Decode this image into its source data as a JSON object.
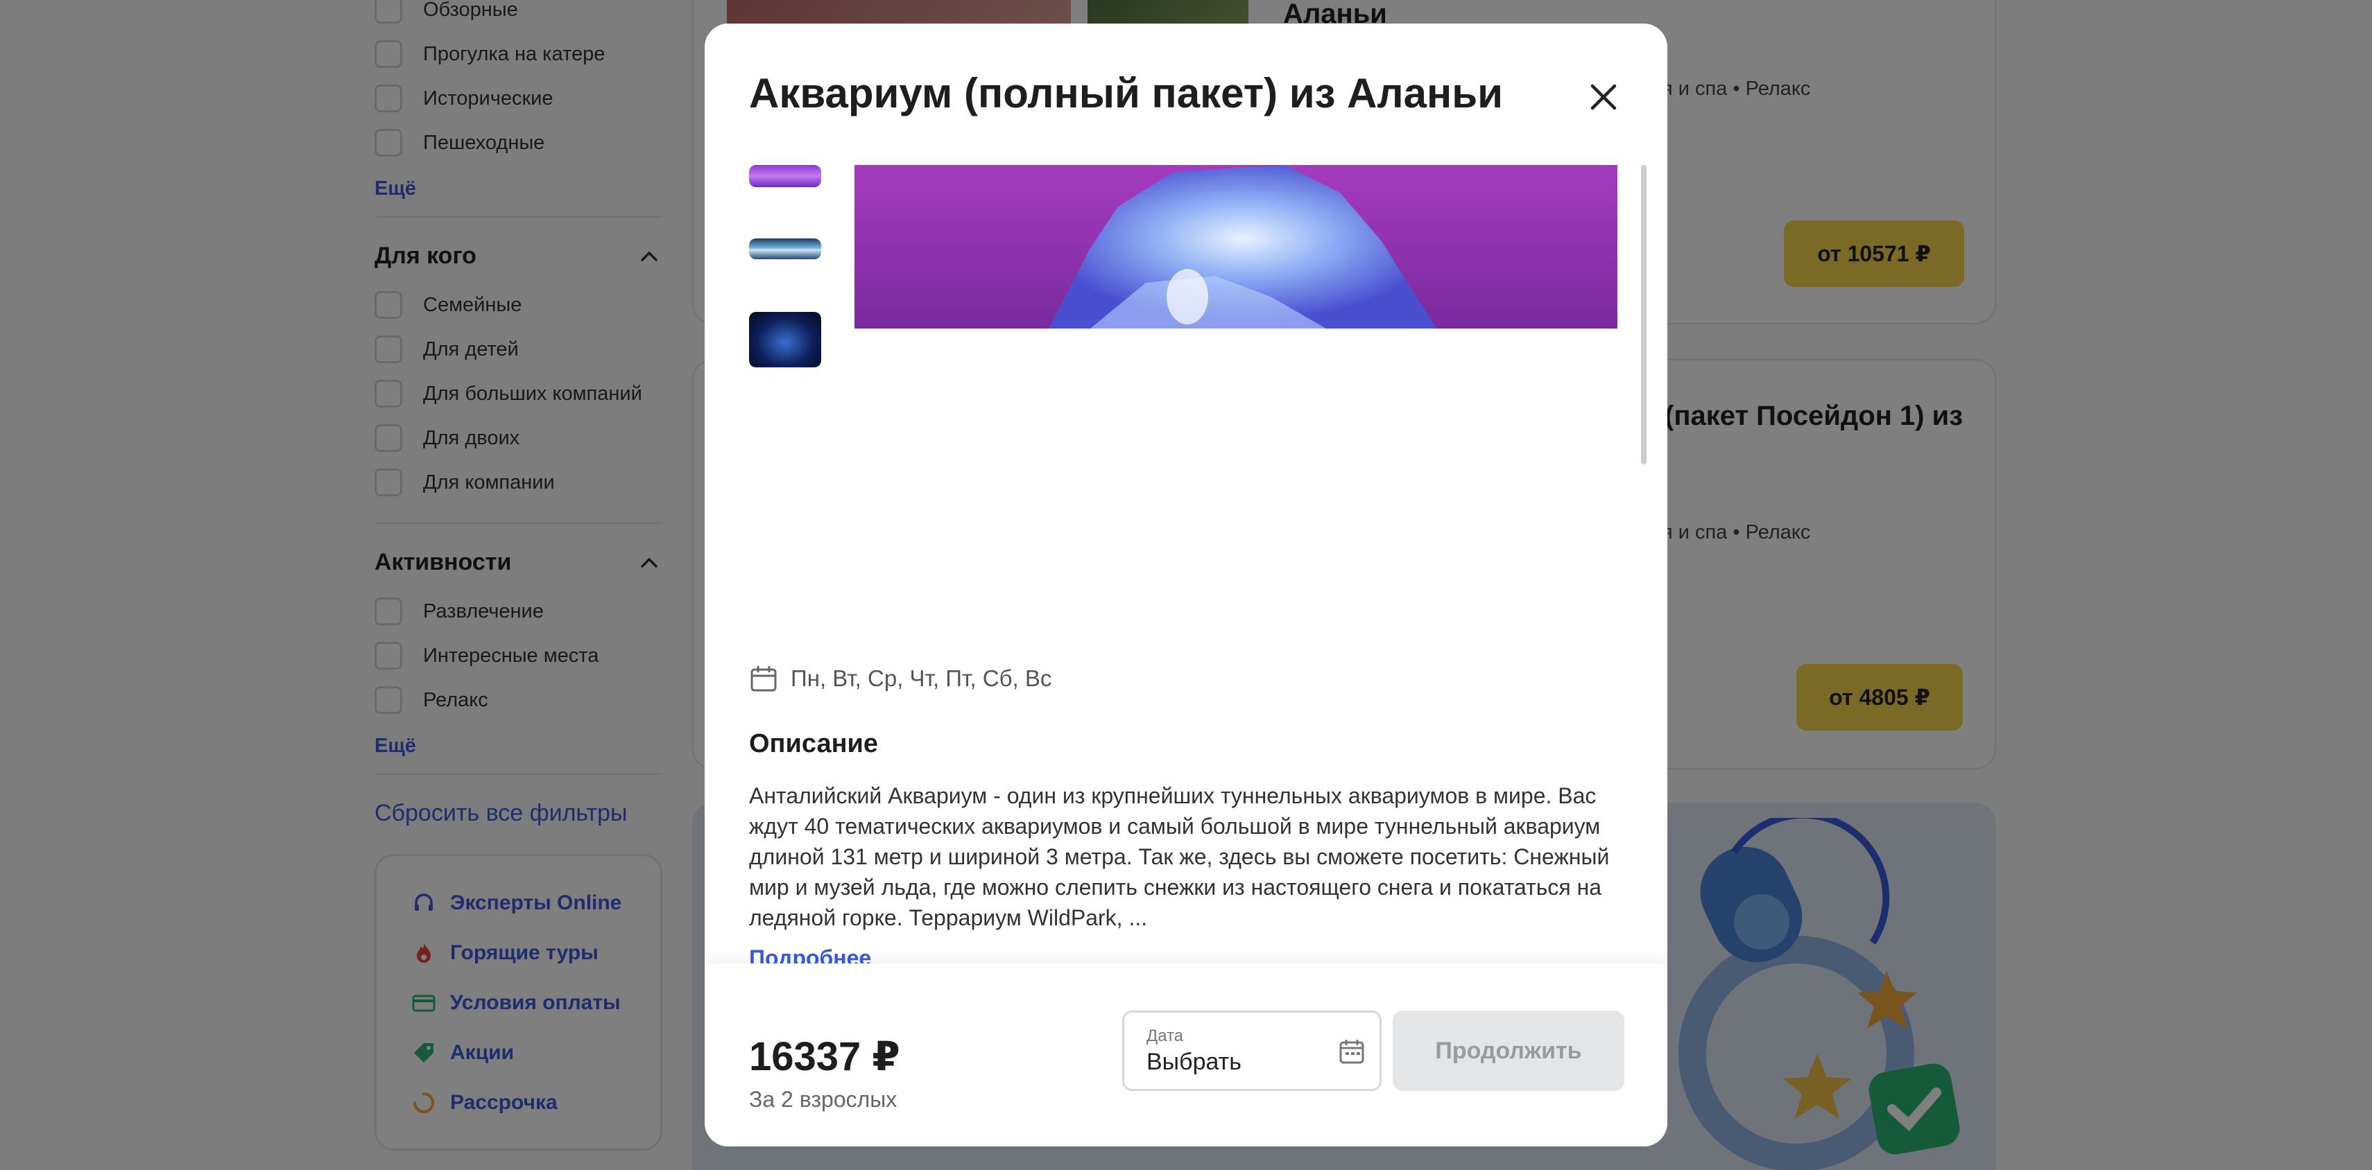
{
  "filters": {
    "type_items": [
      "Обзорные",
      "Прогулка на катере",
      "Исторические",
      "Пешеходные"
    ],
    "type_more": "Ещё",
    "audience_title": "Для кого",
    "audience_items": [
      "Семейные",
      "Для детей",
      "Для больших компаний",
      "Для двоих",
      "Для компании"
    ],
    "activity_title": "Активности",
    "activity_items": [
      "Развлечение",
      "Интересные места",
      "Релакс"
    ],
    "activity_more": "Ещё",
    "reset": "Сбросить все фильтры"
  },
  "help_links": [
    {
      "label": "Эксперты Online",
      "icon": "headset-icon",
      "color": "#3b5bdb"
    },
    {
      "label": "Горящие туры",
      "icon": "fire-icon",
      "color": "#e8453c"
    },
    {
      "label": "Условия оплаты",
      "icon": "card-icon",
      "color": "#2bb673"
    },
    {
      "label": "Акции",
      "icon": "tag-icon",
      "color": "#2bb673"
    },
    {
      "label": "Рассрочка",
      "icon": "installment-icon",
      "color": "#f2a93b"
    }
  ],
  "cards": [
    {
      "title_fragment": "Аланьи",
      "tags": "ня и спа • Релакс",
      "price": "от 10571 ₽"
    },
    {
      "title_fragment": "(пакет Посейдон 1) из",
      "tags": "ня и спа • Релакс",
      "price": "от 4805 ₽"
    }
  ],
  "modal": {
    "title": "Аквариум (полный пакет) из Аланьи",
    "days": "Пн, Вт, Ср, Чт, Пт, Сб, Вс",
    "description_title": "Описание",
    "description": "Анталийский Аквариум - один из крупнейших туннельных аквариумов в мире. Вас ждут 40 тематических аквариумов и самый большой в мире туннельный аквариум длиной 131 метр и шириной 3 метра. Так же, здесь вы сможете посетить: Снежный мир и музей льда, где можно слепить снежки из настоящего снега и покататься на ледяной горке. Террариум WildPark, ...",
    "read_more": "Подробнее",
    "price": "16337 ₽",
    "price_note": "За 2 взрослых",
    "date_label": "Дата",
    "date_value": "Выбрать",
    "continue": "Продолжить"
  },
  "colors": {
    "accent": "#3b5bdb",
    "price_button": "#f7d44c",
    "disabled_button": "#e4e5e7"
  }
}
